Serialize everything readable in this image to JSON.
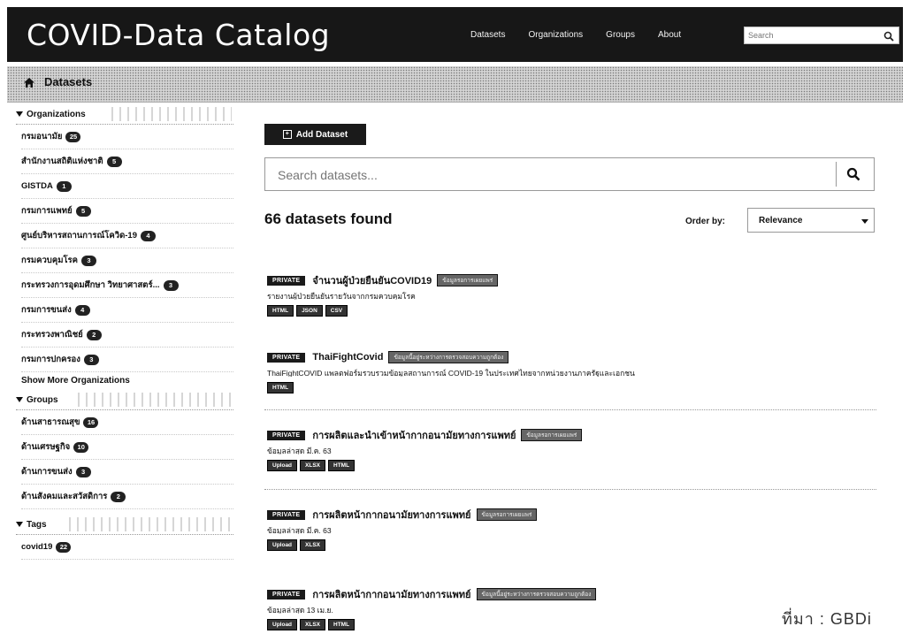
{
  "header": {
    "title": "COVID-Data Catalog",
    "nav": [
      "Datasets",
      "Organizations",
      "Groups",
      "About"
    ],
    "search_placeholder": "Search"
  },
  "breadcrumb": {
    "label": "Datasets"
  },
  "sidebar": {
    "organizations_heading": "Organizations",
    "organizations": [
      {
        "label": "กรมอนามัย",
        "count": "25"
      },
      {
        "label": "สำนักงานสถิติแห่งชาติ",
        "count": "5"
      },
      {
        "label": "GISTDA",
        "count": "1"
      },
      {
        "label": "กรมการแพทย์",
        "count": "5"
      },
      {
        "label": "ศูนย์บริหารสถานการณ์โควิด-19",
        "count": "4"
      },
      {
        "label": "กรมควบคุมโรค",
        "count": "3"
      },
      {
        "label": "กระทรวงการอุดมศึกษา วิทยาศาสตร์...",
        "count": "3"
      },
      {
        "label": "กรมการขนส่ง",
        "count": "4"
      },
      {
        "label": "กระทรวงพาณิชย์",
        "count": "2"
      },
      {
        "label": "กรมการปกครอง",
        "count": "3"
      }
    ],
    "show_more": "Show More Organizations",
    "groups_heading": "Groups",
    "groups": [
      {
        "label": "ด้านสาธารณสุข",
        "count": "16"
      },
      {
        "label": "ด้านเศรษฐกิจ",
        "count": "10"
      },
      {
        "label": "ด้านการขนส่ง",
        "count": "3"
      },
      {
        "label": "ด้านสังคมและสวัสดิการ",
        "count": "2"
      }
    ],
    "tags_heading": "Tags",
    "tags": [
      {
        "label": "covid19",
        "count": "22"
      }
    ]
  },
  "main": {
    "add_button": "Add Dataset",
    "search_placeholder": "Search datasets...",
    "found_text": "66 datasets found",
    "order_label": "Order by:",
    "order_value": "Relevance",
    "datasets": [
      {
        "badge": "PRIVATE",
        "title": "จำนวนผู้ป่วยยืนยันCOVID19",
        "draft": "ข้อมูลรอการเผยแพร่",
        "desc": "รายงานผู้ป่วยยืนยันรายวันจากกรมควบคุมโรค",
        "formats": [
          "HTML",
          "JSON",
          "CSV"
        ]
      },
      {
        "badge": "PRIVATE",
        "title": "ThaiFightCovid",
        "draft": "ข้อมูลนี้อยู่ระหว่างการตรวจสอบความถูกต้อง",
        "desc": "ThaiFightCOVID แพลตฟอร์มรวบรวมข้อมูลสถานการณ์ COVID-19 ในประเทศไทยจากหน่วยงานภาครัฐและเอกชน",
        "formats": [
          "HTML"
        ]
      },
      {
        "badge": "PRIVATE",
        "title": "การผลิตและนำเข้าหน้ากากอนามัยทางการแพทย์",
        "draft": "ข้อมูลรอการเผยแพร่",
        "desc": "ข้อมูลล่าสุด มี.ค. 63",
        "formats": [
          "Upload",
          "XLSX",
          "HTML"
        ]
      },
      {
        "badge": "PRIVATE",
        "title": "การผลิตหน้ากากอนามัยทางการแพทย์",
        "draft": "ข้อมูลรอการเผยแพร่",
        "desc": "ข้อมูลล่าสุด มี.ค. 63",
        "formats": [
          "Upload",
          "XLSX"
        ]
      },
      {
        "badge": "PRIVATE",
        "title": "การผลิตหน้ากากอนามัยทางการแพทย์",
        "draft": "ข้อมูลนี้อยู่ระหว่างการตรวจสอบความถูกต้อง",
        "desc": "ข้อมูลล่าสุด 13 เม.ย.",
        "formats": [
          "Upload",
          "XLSX",
          "HTML"
        ]
      }
    ]
  },
  "watermark": "ที่มา : GBDi"
}
